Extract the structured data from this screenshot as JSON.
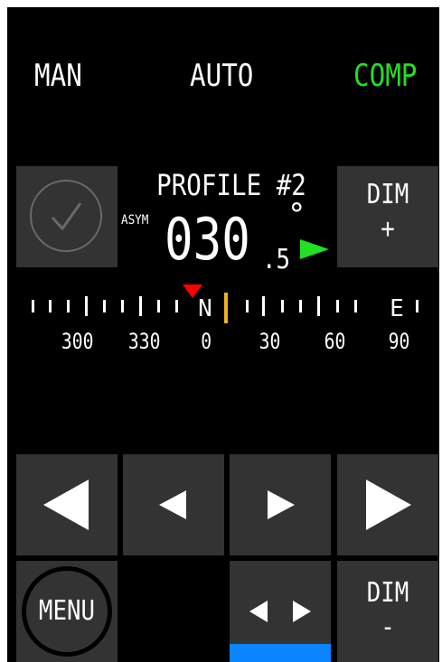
{
  "modes": {
    "man": "MAN",
    "auto": "AUTO",
    "comp": "COMP",
    "active_color": "#22e022"
  },
  "profile": {
    "label": "PROFILE #2",
    "asym": "ASYM"
  },
  "heading": {
    "main": "030",
    "decimal": ".5",
    "unit": "°"
  },
  "dim_plus": {
    "line1": "DIM",
    "line2": "+"
  },
  "dim_minus": {
    "line1": "DIM",
    "line2": "-"
  },
  "menu": {
    "label": "MENU"
  },
  "scale": {
    "cardinals": {
      "n": "N",
      "e": "E"
    },
    "labels": [
      "300",
      "330",
      "0",
      "30",
      "60",
      "90"
    ],
    "heading_marker_color": "#f0b020",
    "target_marker_color": "#ff0000"
  },
  "buttons": {
    "port_large": "left-arrow-large-icon",
    "port_small": "left-arrow-small-icon",
    "stbd_small": "right-arrow-small-icon",
    "stbd_large": "right-arrow-large-icon",
    "both": "left-right-arrows-icon",
    "both_indicator_color": "#0a84ff"
  }
}
